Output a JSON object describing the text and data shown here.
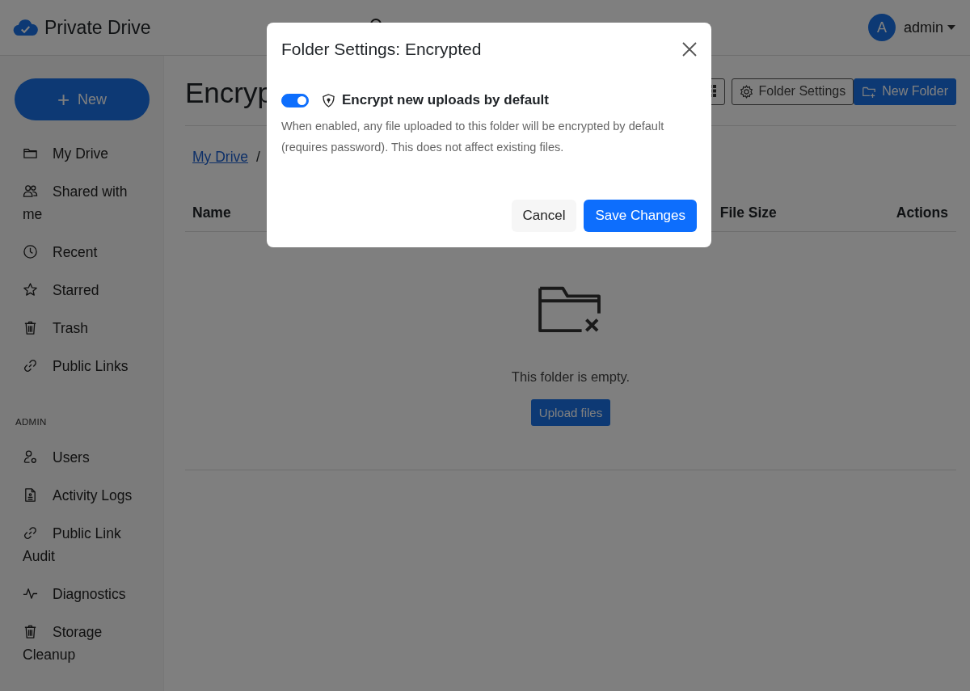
{
  "header": {
    "app_name": "Private Drive",
    "user": {
      "initial": "A",
      "name": "admin"
    }
  },
  "sidebar": {
    "new_button": {
      "icon": "+",
      "label": "New"
    },
    "items": [
      {
        "kind": "folder",
        "label": "My Drive"
      },
      {
        "kind": "people",
        "label": "Shared with me"
      },
      {
        "kind": "clock",
        "label": "Recent"
      },
      {
        "kind": "star",
        "label": "Starred"
      },
      {
        "kind": "trash",
        "label": "Trash"
      },
      {
        "kind": "link",
        "label": "Public Links"
      }
    ],
    "admin_heading": "ADMIN",
    "admin_items": [
      {
        "kind": "user-gear",
        "label": "Users"
      },
      {
        "kind": "document",
        "label": "Activity Logs"
      },
      {
        "kind": "link",
        "label": "Public Link Audit"
      },
      {
        "kind": "pulse",
        "label": "Diagnostics"
      },
      {
        "kind": "trash",
        "label": "Storage Cleanup"
      }
    ]
  },
  "main": {
    "title": "Encryp",
    "toolbar": [
      {
        "kind": "grid"
      },
      {
        "kind": "settings",
        "label": "Folder Settings"
      },
      {
        "kind": "new-folder",
        "label": "New Folder"
      }
    ],
    "breadcrumb": [
      {
        "label": "My Drive"
      }
    ],
    "breadcrumb_separator": "/",
    "table": {
      "columns": [
        "Name",
        "File Size",
        "Actions"
      ]
    },
    "empty_state": {
      "message": "This folder is empty.",
      "button": "Upload files"
    }
  },
  "modal": {
    "title": "Folder Settings: Encrypted",
    "toggle": {
      "on": true,
      "label": "Encrypt new uploads by default"
    },
    "description": "When enabled, any file uploaded to this folder will be encrypted by default (requires password). This does not affect existing files.",
    "buttons": [
      {
        "kind": "secondary",
        "label": "Cancel"
      },
      {
        "kind": "primary",
        "label": "Save Changes"
      }
    ]
  }
}
